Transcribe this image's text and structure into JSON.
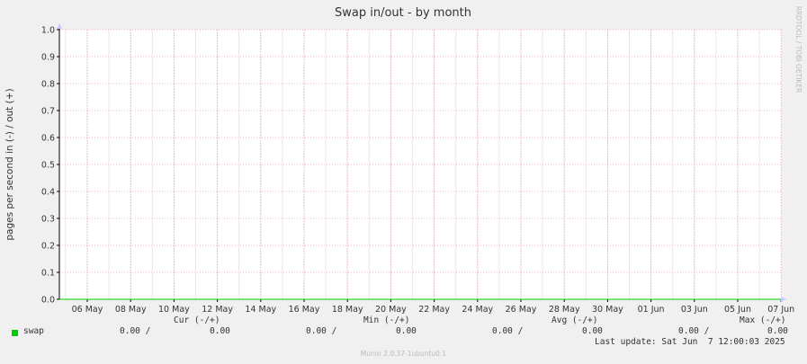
{
  "chart_data": {
    "type": "line",
    "title": "Swap in/out - by month",
    "ylabel": "pages per second in (-) / out (+)",
    "xlabel": "",
    "watermark": "RRDTOOL / TOBI OETIKER",
    "x_ticks": [
      "06 May",
      "08 May",
      "10 May",
      "12 May",
      "14 May",
      "16 May",
      "18 May",
      "20 May",
      "22 May",
      "24 May",
      "26 May",
      "28 May",
      "30 May",
      "01 Jun",
      "03 Jun",
      "05 Jun",
      "07 Jun"
    ],
    "y_ticks": [
      "0.0",
      "0.1",
      "0.2",
      "0.3",
      "0.4",
      "0.5",
      "0.6",
      "0.7",
      "0.8",
      "0.9",
      "1.0"
    ],
    "ylim": [
      0,
      1
    ],
    "grid": true,
    "series": [
      {
        "name": "swap",
        "color": "#00cc00",
        "values": [
          0,
          0,
          0,
          0,
          0,
          0,
          0,
          0,
          0,
          0,
          0,
          0,
          0,
          0,
          0,
          0,
          0
        ]
      }
    ]
  },
  "legend": {
    "headers": {
      "cur": "Cur (-/+)",
      "min": "Min (-/+)",
      "avg": "Avg (-/+)",
      "max": "Max (-/+)"
    },
    "rows": [
      {
        "name": "swap",
        "color": "#00cc00",
        "cur_in": "0.00 /",
        "cur_out": "0.00",
        "min_in": "0.00 /",
        "min_out": "0.00",
        "avg_in": "0.00 /",
        "avg_out": "0.00",
        "max_in": "0.00 /",
        "max_out": "0.00"
      }
    ]
  },
  "last_update": "Last update: Sat Jun  7 12:00:03 2025",
  "footer": "Munin 2.0.37-1ubuntu0.1"
}
